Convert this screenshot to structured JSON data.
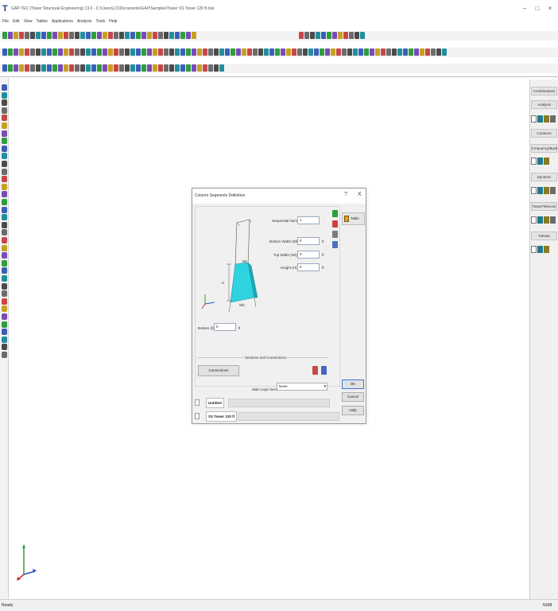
{
  "window": {
    "title": "GAP-TEC (Tower Structural Engineering) 13.0 - C:\\Users\\LCI\\Documents\\GAP\\Samples\\Tower SS Tower 120 ft.tow",
    "app_glyph": "T",
    "minimize": "–",
    "maximize": "□",
    "close": "×"
  },
  "menu": [
    "File",
    "Edit",
    "View",
    "Tables",
    "Applications",
    "Analysis",
    "Tools",
    "Help"
  ],
  "right_panel": {
    "headers": [
      "Combinations",
      "Analysis",
      "Contours",
      "Frequency/Buck.",
      "Dynamic",
      "Tower/Telecom",
      "Tubular"
    ]
  },
  "status": {
    "left": "Ready",
    "right": "NUM"
  },
  "dialog": {
    "title": "Column Segments Definition",
    "help_glyph": "?",
    "close_glyph": "X",
    "fields": {
      "sequential_number": {
        "label": "Sequential Number",
        "value": "1"
      },
      "bottom_width": {
        "label": "Bottom Width (Wb)",
        "value": "0",
        "unit": "ft"
      },
      "top_width": {
        "label": "Top Width (Wt)",
        "value": "0",
        "unit": "ft"
      },
      "height": {
        "label": "Height (H)",
        "value": "0",
        "unit": "ft"
      },
      "bottom_at": {
        "label": "Bottom @",
        "value": "0",
        "unit": "ft"
      }
    },
    "figure_labels": {
      "wt": "Wt",
      "h": "H",
      "wb": "Wb"
    },
    "table_button": "Table",
    "sections_header": "Sections and Connections",
    "connections_button": "Connections",
    "main_legs_label": "Main Legs Section",
    "main_legs_value": "None",
    "ok": "OK",
    "cancel": "Cancel",
    "help": "Help",
    "tabs": [
      "Untitled",
      "SS Tower 120 ft"
    ]
  }
}
